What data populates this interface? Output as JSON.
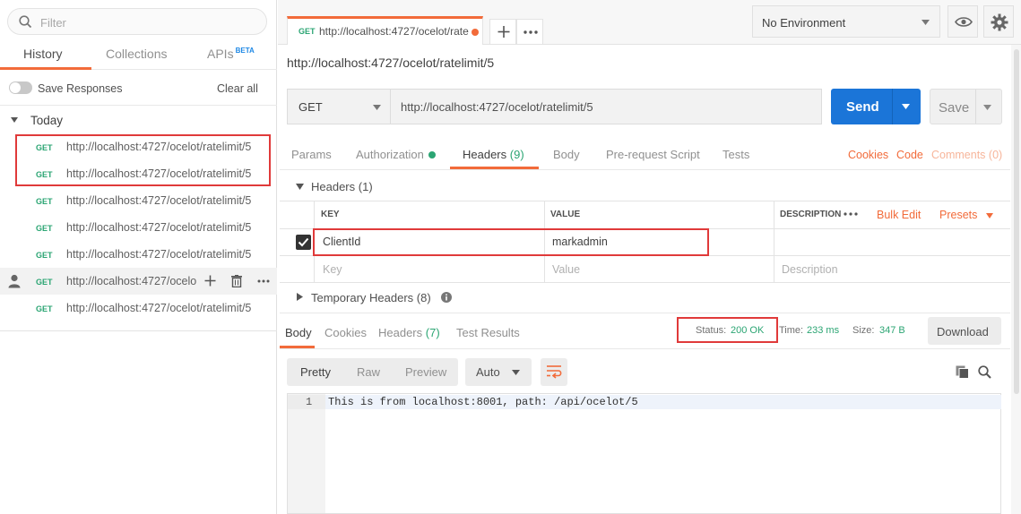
{
  "sidebar": {
    "filter_placeholder": "Filter",
    "tabs": {
      "history": "History",
      "collections": "Collections",
      "apis": "APIs",
      "beta": "BETA"
    },
    "save_responses": "Save Responses",
    "clear_all": "Clear all",
    "group": "Today",
    "history": [
      {
        "method": "GET",
        "url": "http://localhost:4727/ocelot/ratelimit/5"
      },
      {
        "method": "GET",
        "url": "http://localhost:4727/ocelot/ratelimit/5"
      },
      {
        "method": "GET",
        "url": "http://localhost:4727/ocelot/ratelimit/5"
      },
      {
        "method": "GET",
        "url": "http://localhost:4727/ocelot/ratelimit/5"
      },
      {
        "method": "GET",
        "url": "http://localhost:4727/ocelot/ratelimit/5"
      },
      {
        "method": "GET",
        "url": "http://localhost:4727/ocelo"
      },
      {
        "method": "GET",
        "url": "http://localhost:4727/ocelot/ratelimit/5"
      }
    ]
  },
  "topbar": {
    "tab_method": "GET",
    "tab_url": "http://localhost:4727/ocelot/rate",
    "environment": "No Environment"
  },
  "request": {
    "name": "http://localhost:4727/ocelot/ratelimit/5",
    "method": "GET",
    "url": "http://localhost:4727/ocelot/ratelimit/5",
    "send": "Send",
    "save": "Save",
    "tabs": {
      "params": "Params",
      "authorization": "Authorization",
      "headers": "Headers",
      "headers_count": "(9)",
      "body": "Body",
      "prerequest": "Pre-request Script",
      "tests": "Tests"
    },
    "links": {
      "cookies": "Cookies",
      "code": "Code",
      "comments": "Comments (0)"
    }
  },
  "headers_section": {
    "title": "Headers",
    "count": "(1)",
    "columns": {
      "key": "KEY",
      "value": "VALUE",
      "description": "DESCRIPTION"
    },
    "bulk_edit": "Bulk Edit",
    "presets": "Presets",
    "rows": [
      {
        "key": "ClientId",
        "value": "markadmin",
        "description": ""
      }
    ],
    "placeholders": {
      "key": "Key",
      "value": "Value",
      "description": "Description"
    },
    "temporary": "Temporary Headers",
    "temporary_count": "(8)"
  },
  "response": {
    "tabs": {
      "body": "Body",
      "cookies": "Cookies",
      "headers": "Headers",
      "headers_count": "(7)",
      "test_results": "Test Results"
    },
    "status_label": "Status:",
    "status_value": "200 OK",
    "time_label": "Time:",
    "time_value": "233 ms",
    "size_label": "Size:",
    "size_value": "347 B",
    "download": "Download",
    "formats": {
      "pretty": "Pretty",
      "raw": "Raw",
      "preview": "Preview"
    },
    "auto": "Auto",
    "line_number": "1",
    "body_text": "This is from localhost:8001, path: /api/ocelot/5"
  },
  "colors": {
    "accent": "#f26b3a",
    "send": "#1b75d8",
    "get": "#2ba573",
    "highlight": "#e03a3a"
  }
}
